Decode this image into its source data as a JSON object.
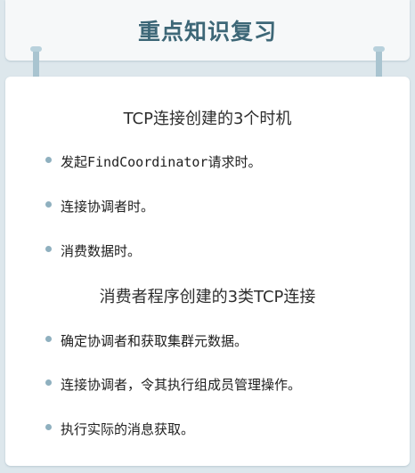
{
  "header": {
    "title": "重点知识复习"
  },
  "sections": [
    {
      "title": "TCP连接创建的3个时机",
      "items": [
        "发起FindCoordinator请求时。",
        "连接协调者时。",
        "消费数据时。"
      ]
    },
    {
      "title": "消费者程序创建的3类TCP连接",
      "items": [
        "确定协调者和获取集群元数据。",
        "连接协调者，令其执行组成员管理操作。",
        "执行实际的消息获取。"
      ]
    }
  ]
}
